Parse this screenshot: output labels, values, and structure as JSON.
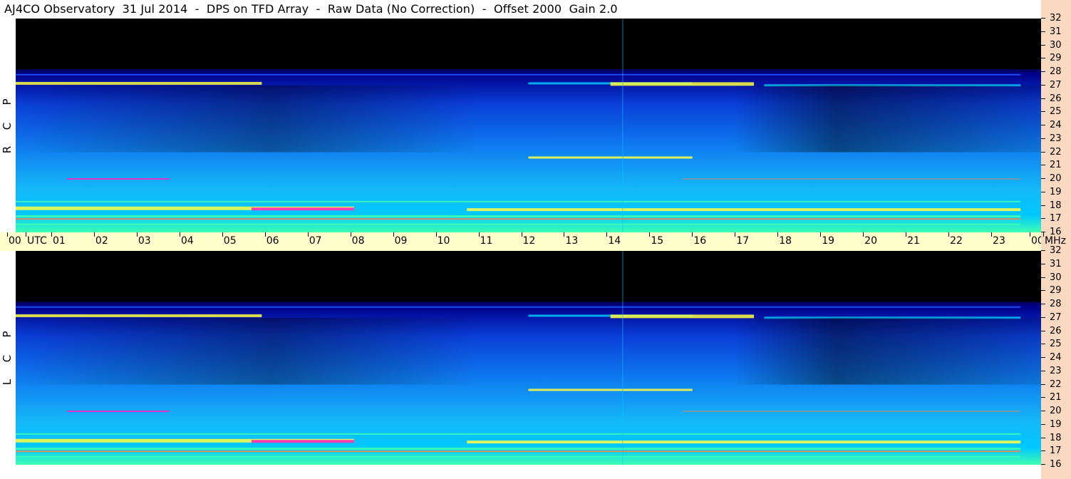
{
  "title": "AJ4CO Observatory  31 Jul 2014  -  DPS on TFD Array  -  Raw Data (No Correction)  -  Offset 2000  Gain 2.0",
  "chart_data": [
    {
      "type": "heatmap",
      "panel": "rcp",
      "ylabel": [
        "R",
        "C",
        "P"
      ],
      "x": [
        "00",
        "01",
        "02",
        "03",
        "04",
        "05",
        "06",
        "07",
        "08",
        "09",
        "10",
        "11",
        "12",
        "13",
        "14",
        "15",
        "16",
        "17",
        "18",
        "19",
        "20",
        "21",
        "22",
        "23",
        "00"
      ],
      "xlim": [
        0,
        24
      ],
      "y_ticks": [
        32,
        31,
        30,
        29,
        28,
        27,
        26,
        25,
        24,
        23,
        22,
        21,
        20,
        19,
        18,
        17,
        16
      ],
      "ylim": [
        16,
        32
      ],
      "colormap": [
        "#000000",
        "#00008b",
        "#1e5aff",
        "#00c8ff",
        "#40ffb0",
        "#ffff40",
        "#ff8040",
        "#ff20c0"
      ]
    },
    {
      "type": "heatmap",
      "panel": "lcp",
      "ylabel": [
        "L",
        "C",
        "P"
      ],
      "x": [
        "00",
        "01",
        "02",
        "03",
        "04",
        "05",
        "06",
        "07",
        "08",
        "09",
        "10",
        "11",
        "12",
        "13",
        "14",
        "15",
        "16",
        "17",
        "18",
        "19",
        "20",
        "21",
        "22",
        "23",
        "00"
      ],
      "xlim": [
        0,
        24
      ],
      "y_ticks": [
        32,
        31,
        30,
        29,
        28,
        27,
        26,
        25,
        24,
        23,
        22,
        21,
        20,
        19,
        18,
        17,
        16
      ],
      "ylim": [
        16,
        32
      ],
      "colormap": [
        "#000000",
        "#00008b",
        "#1e5aff",
        "#00c8ff",
        "#40ffb0",
        "#ffff40",
        "#ff8040",
        "#ff20c0"
      ]
    }
  ],
  "time_axis": {
    "labels": [
      "00",
      "UTC",
      "01",
      "02",
      "03",
      "04",
      "05",
      "06",
      "07",
      "08",
      "09",
      "10",
      "11",
      "12",
      "13",
      "14",
      "15",
      "16",
      "17",
      "18",
      "19",
      "20",
      "21",
      "22",
      "23",
      "00"
    ],
    "unit": "MHz"
  }
}
